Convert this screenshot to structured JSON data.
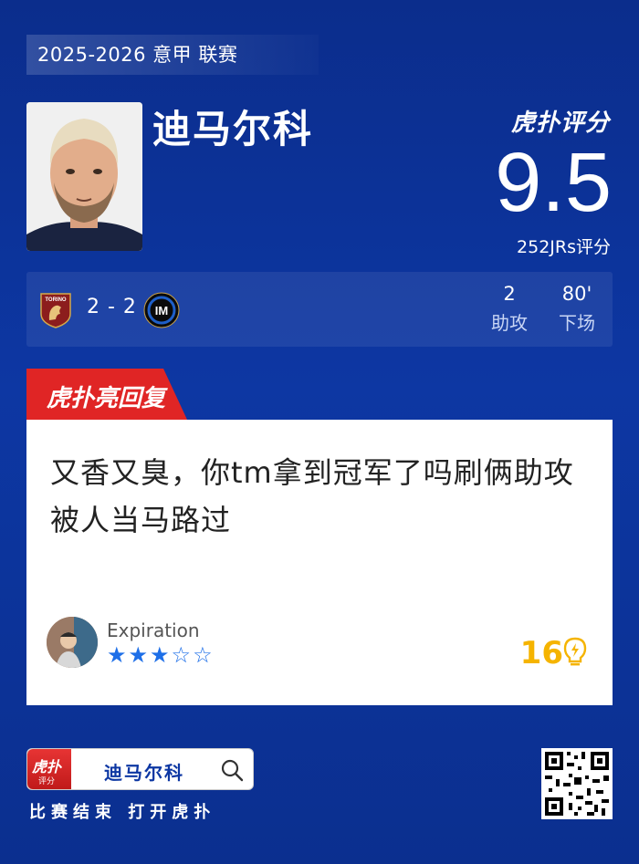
{
  "league": "2025-2026 意甲 联赛",
  "player": {
    "name": "迪马尔科"
  },
  "rating": {
    "brand": "虎扑评分",
    "score": "9.5",
    "votes": "252JRs评分"
  },
  "match": {
    "home_club_icon": "torino-crest-icon",
    "away_club_icon": "inter-crest-icon",
    "home_crest_text": "TORINO",
    "result": "2 - 2",
    "stats": [
      {
        "value": "2",
        "label": "助攻"
      },
      {
        "value": "80'",
        "label": "下场"
      }
    ]
  },
  "highlight_tag": "虎扑亮回复",
  "comment": {
    "text": "又香又臭，你tm拿到冠军了吗刷俩助攻被人当马路过",
    "username": "Expiration",
    "stars_rating": 3,
    "stars_max": 5,
    "stars_display": "★★★☆☆",
    "likes": "16"
  },
  "footer": {
    "app_name": "虎扑",
    "app_sub": "评分",
    "search_text": "迪马尔科",
    "cta": "比赛结束 打开虎扑"
  },
  "colors": {
    "background": "#0d37a3",
    "accent_red": "#e02525",
    "star_blue": "#1e6fe8",
    "like_gold": "#f5b400"
  }
}
